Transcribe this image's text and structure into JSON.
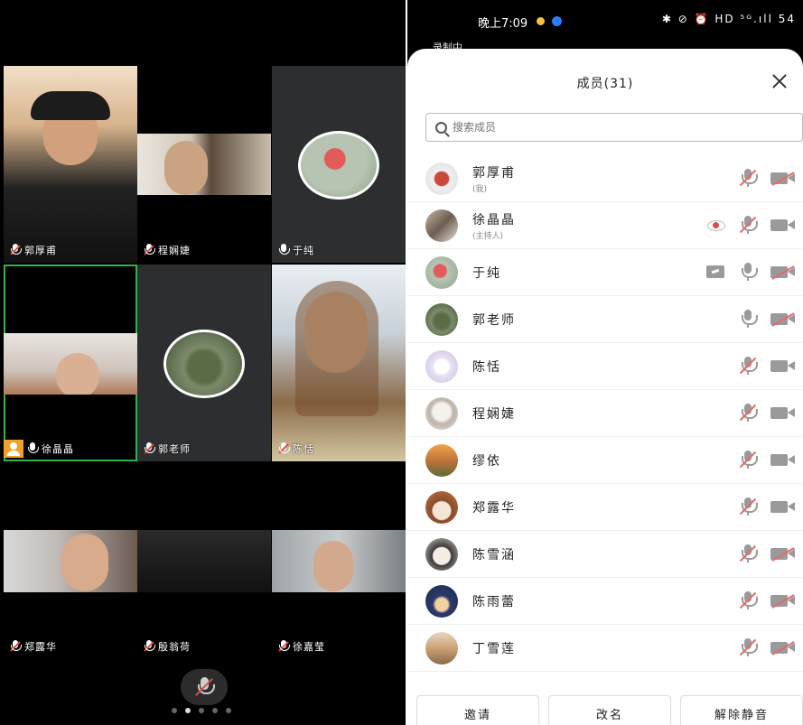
{
  "video_grid": {
    "tiles": [
      {
        "name": "郭厚甫",
        "mic": "muted"
      },
      {
        "name": "程娴婕",
        "mic": "muted"
      },
      {
        "name": "于纯",
        "mic": "on"
      },
      {
        "name": "徐晶晶",
        "mic": "on",
        "host": true,
        "active": true
      },
      {
        "name": "郭老师",
        "mic": "muted"
      },
      {
        "name": "陈恬",
        "mic": "muted"
      },
      {
        "name": "郑露华",
        "mic": "muted"
      },
      {
        "name": "殷翁荷",
        "mic": "muted"
      },
      {
        "name": "徐嘉莹",
        "mic": "muted"
      }
    ],
    "page_dots": 5,
    "active_page": 1
  },
  "status_bar": {
    "time": "晚上7:09",
    "right_icons": "✱ ⊘ ⏰ HD ⁵ᴳ.ıll 54",
    "recording": "录制中"
  },
  "members_panel": {
    "title": "成员(31)",
    "search_placeholder": "搜索成员",
    "members": [
      {
        "name": "郭厚甫",
        "sub": "(我)",
        "mic": "off",
        "cam": "off",
        "extra": ""
      },
      {
        "name": "徐晶晶",
        "sub": "(主持人)",
        "mic": "off",
        "cam": "on",
        "extra": "eye"
      },
      {
        "name": "于纯",
        "sub": "",
        "mic": "on",
        "cam": "off",
        "extra": "share"
      },
      {
        "name": "郭老师",
        "sub": "",
        "mic": "on",
        "cam": "off",
        "extra": ""
      },
      {
        "name": "陈恬",
        "sub": "",
        "mic": "off",
        "cam": "on",
        "extra": ""
      },
      {
        "name": "程娴婕",
        "sub": "",
        "mic": "off",
        "cam": "on",
        "extra": ""
      },
      {
        "name": "缪依",
        "sub": "",
        "mic": "off",
        "cam": "on",
        "extra": ""
      },
      {
        "name": "郑露华",
        "sub": "",
        "mic": "off",
        "cam": "on",
        "extra": ""
      },
      {
        "name": "陈雪涵",
        "sub": "",
        "mic": "off",
        "cam": "off",
        "extra": ""
      },
      {
        "name": "陈雨蕾",
        "sub": "",
        "mic": "off",
        "cam": "off",
        "extra": ""
      },
      {
        "name": "丁雪莲",
        "sub": "",
        "mic": "off",
        "cam": "off",
        "extra": ""
      }
    ],
    "buttons": {
      "invite": "邀请",
      "rename": "改名",
      "unmute_all": "解除静音"
    }
  },
  "colors": {
    "active_border": "#2fb34e",
    "muted_red": "#e14b4b",
    "host_badge": "#f0a12b"
  }
}
